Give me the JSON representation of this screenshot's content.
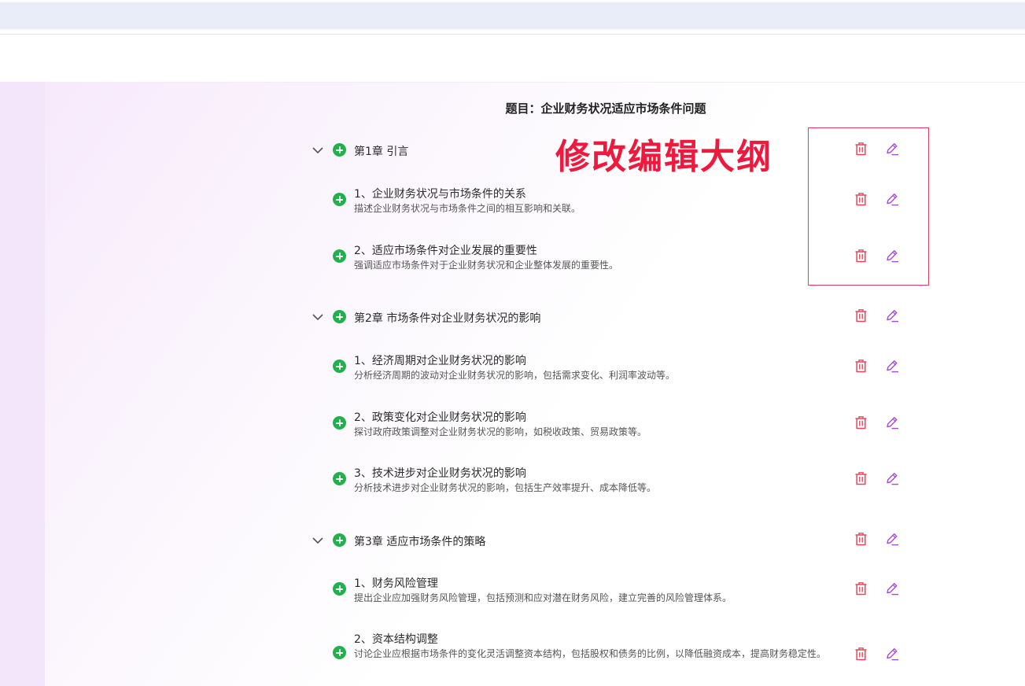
{
  "outline": {
    "title": "题目：企业财务状况适应市场条件问题",
    "annotation": "修改编辑大纲",
    "chapters": [
      {
        "label": "第1章 引言",
        "sections": [
          {
            "label": "1、企业财务状况与市场条件的关系",
            "desc": "描述企业财务状况与市场条件之间的相互影响和关联。"
          },
          {
            "label": "2、适应市场条件对企业发展的重要性",
            "desc": "强调适应市场条件对于企业财务状况和企业整体发展的重要性。"
          }
        ]
      },
      {
        "label": "第2章 市场条件对企业财务状况的影响",
        "sections": [
          {
            "label": "1、经济周期对企业财务状况的影响",
            "desc": "分析经济周期的波动对企业财务状况的影响，包括需求变化、利润率波动等。"
          },
          {
            "label": "2、政策变化对企业财务状况的影响",
            "desc": "探讨政府政策调整对企业财务状况的影响，如税收政策、贸易政策等。"
          },
          {
            "label": "3、技术进步对企业财务状况的影响",
            "desc": "分析技术进步对企业财务状况的影响，包括生产效率提升、成本降低等。"
          }
        ]
      },
      {
        "label": "第3章 适应市场条件的策略",
        "sections": [
          {
            "label": "1、财务风险管理",
            "desc": "提出企业应加强财务风险管理，包括预测和应对潜在财务风险，建立完善的风险管理体系。"
          },
          {
            "label": "2、资本结构调整",
            "desc": "讨论企业应根据市场条件的变化灵活调整资本结构，包括股权和债务的比例，以降低融资成本，提高财务稳定性。"
          }
        ]
      }
    ]
  },
  "colors": {
    "add": "#21b14c",
    "delete": "#e8455a",
    "edit": "#a64bd9",
    "annotation": "#f0183c"
  }
}
